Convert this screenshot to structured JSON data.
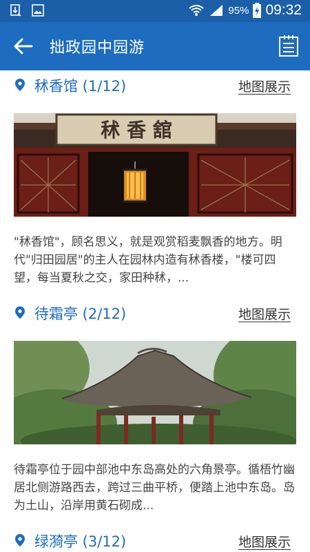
{
  "status_bar": {
    "battery": "95%",
    "time": "09:32",
    "icons": [
      "download-icon",
      "image-icon",
      "wifi-icon",
      "signal-icon",
      "battery-icon"
    ]
  },
  "app_bar": {
    "title": "拙政园中园游",
    "back_icon": "arrow-left-icon",
    "menu_icon": "list-notes-icon"
  },
  "entries": [
    {
      "title": "秫香馆 (1/12)",
      "map_label": "地图展示",
      "description": "\"秫香馆\"，顾名思义，就是观赏稻麦飘香的地方。明代\"归田园居\"的主人在园林内造有秫香楼，\"楼可四望，每当夏秋之交，家田种秫，..."
    },
    {
      "title": "待霜亭 (2/12)",
      "map_label": "地图展示",
      "description": "待霜亭位于园中部池中东岛高处的六角景亭。循梧竹幽居北侧游路西去，跨过三曲平桥，便踏上池中东岛。岛为土山，沿岸用黄石砌成..."
    },
    {
      "title": "绿漪亭 (3/12)",
      "map_label": "地图展示"
    }
  ],
  "sign_text": "秫 香 舘",
  "colors": {
    "status_bar": "#1a5fa8",
    "app_bar": "#1e6cbf",
    "accent": "#1e6cbf",
    "text": "#444444"
  }
}
